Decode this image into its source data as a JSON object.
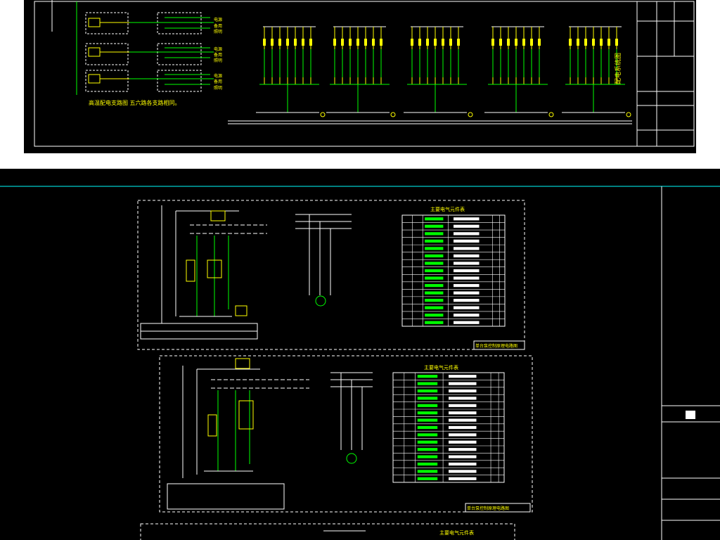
{
  "top_sheet": {
    "note": "高温配电支路图 五六路各支路相同。",
    "left_labels": [
      "电源",
      "备用",
      "照明",
      "电源",
      "备用",
      "照明",
      "电源",
      "备用",
      "照明"
    ],
    "title_vertical": "配电系统图"
  },
  "bottom_sheet": {
    "table1_title": "主要电气元件表",
    "table2_title": "主要电气元件表",
    "table3_title": "主要电气元件表",
    "caption1": "单台泵控制原理电路图",
    "caption2": "单台泵控制原理电路图"
  },
  "colors": {
    "background": "#000000",
    "line_green": "#00ff00",
    "line_yellow": "#ffff00",
    "line_white": "#ffffff",
    "line_cyan": "#00ffff",
    "line_red": "#ff0000",
    "line_magenta": "#ff00ff"
  }
}
